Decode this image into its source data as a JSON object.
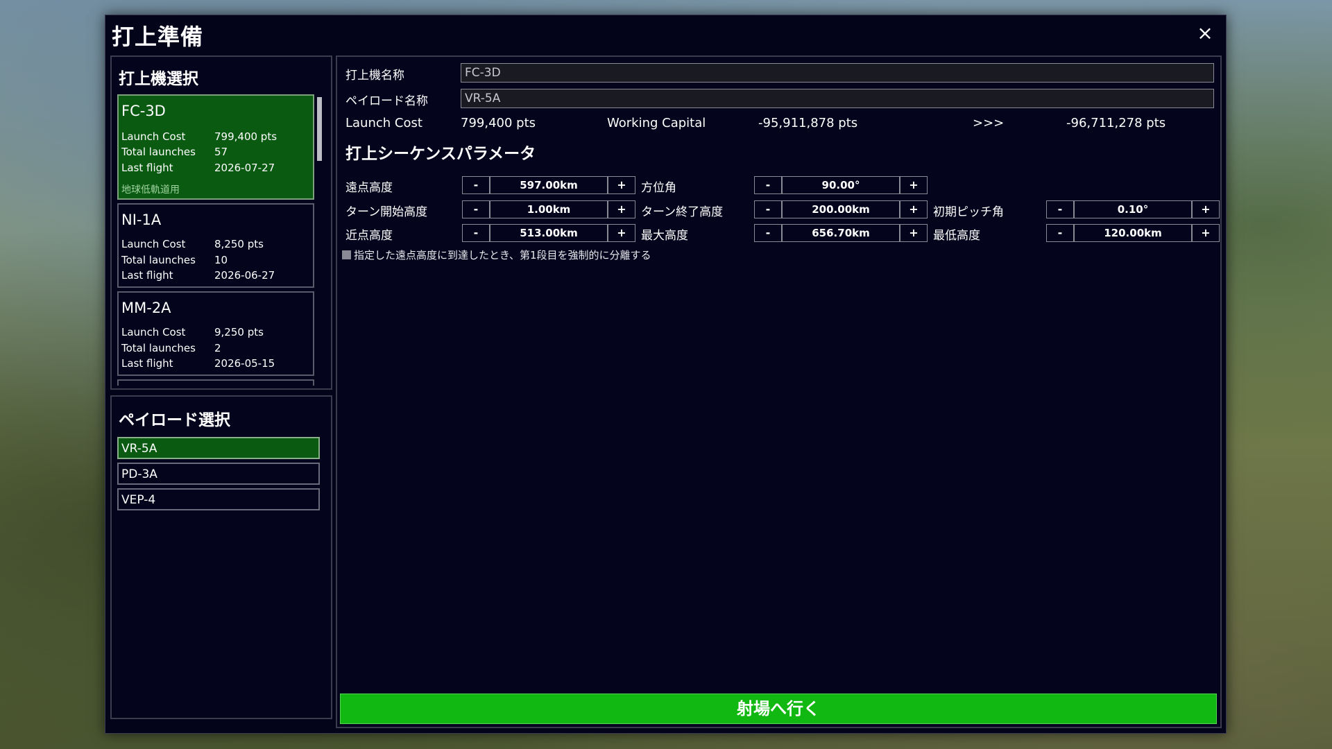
{
  "window": {
    "title": "打上準備",
    "close_icon": "×"
  },
  "vehicle_panel": {
    "title": "打上機選択",
    "vehicles": [
      {
        "name": "FC-3D",
        "cost_label": "Launch Cost",
        "cost": "799,400 pts",
        "launches_label": "Total launches",
        "launches": "57",
        "last_label": "Last flight",
        "last": "2026-07-27",
        "tag": "地球低軌道用"
      },
      {
        "name": "NI-1A",
        "cost_label": "Launch Cost",
        "cost": "8,250 pts",
        "launches_label": "Total launches",
        "launches": "10",
        "last_label": "Last flight",
        "last": "2026-06-27"
      },
      {
        "name": "MM-2A",
        "cost_label": "Launch Cost",
        "cost": "9,250 pts",
        "launches_label": "Total launches",
        "launches": "2",
        "last_label": "Last flight",
        "last": "2026-05-15"
      }
    ]
  },
  "payload_panel": {
    "title": "ペイロード選択",
    "payloads": [
      "VR-5A",
      "PD-3A",
      "VEP-4"
    ]
  },
  "details": {
    "vehicle_name_label": "打上機名称",
    "vehicle_name_value": "FC-3D",
    "payload_name_label": "ペイロード名称",
    "payload_name_value": "VR-5A",
    "launch_cost_label": "Launch Cost",
    "launch_cost_value": "799,400 pts",
    "working_capital_label": "Working Capital",
    "working_capital_value": "-95,911,878 pts",
    "arrow": ">>>",
    "result_value": "-96,711,278 pts"
  },
  "params": {
    "title": "打上シーケンスパラメータ",
    "apogee_label": "遠点高度",
    "apogee_value": "597.00km",
    "azimuth_label": "方位角",
    "azimuth_value": "90.00°",
    "turn_start_label": "ターン開始高度",
    "turn_start_value": "1.00km",
    "turn_end_label": "ターン終了高度",
    "turn_end_value": "200.00km",
    "pitch_label": "初期ピッチ角",
    "pitch_value": "0.10°",
    "perigee_label": "近点高度",
    "perigee_value": "513.00km",
    "max_alt_label": "最大高度",
    "max_alt_value": "656.70km",
    "min_alt_label": "最低高度",
    "min_alt_value": "120.00km",
    "minus": "-",
    "plus": "+",
    "checkbox_label": "指定した遠点高度に到達したとき、第1段目を強制的に分離する"
  },
  "launch_button": "射場へ行く"
}
